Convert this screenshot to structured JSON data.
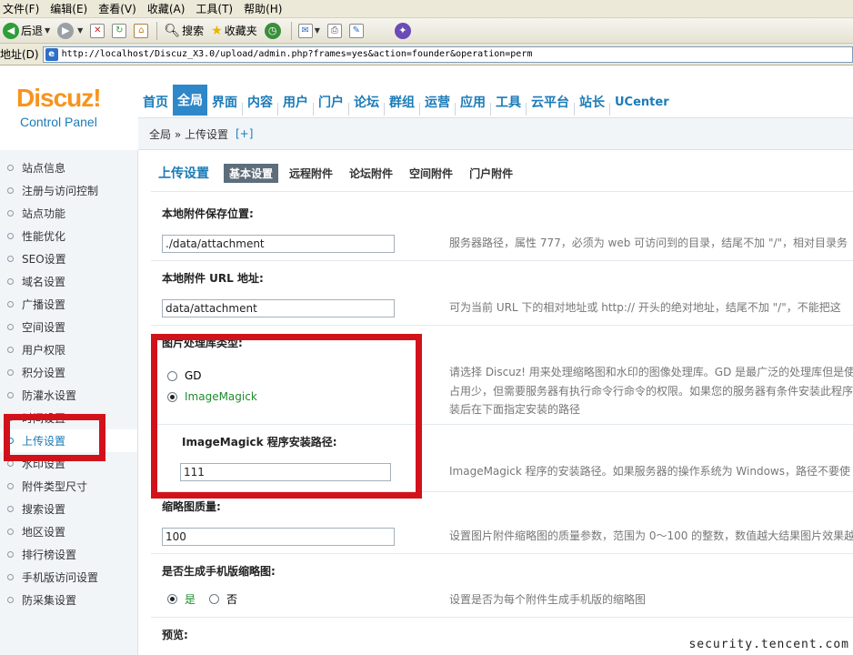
{
  "browser": {
    "menu": [
      "文件(F)",
      "编辑(E)",
      "查看(V)",
      "收藏(A)",
      "工具(T)",
      "帮助(H)"
    ],
    "toolbar": {
      "back": "后退",
      "search": "搜索",
      "favorites": "收藏夹"
    },
    "address_label": "地址(D)",
    "url": "http://localhost/Discuz_X3.0/upload/admin.php?frames=yes&action=founder&operation=perm"
  },
  "header": {
    "logo_main": "Discuz!",
    "logo_sub": "Control Panel",
    "nav": [
      "首页",
      "全局",
      "界面",
      "内容",
      "用户",
      "门户",
      "论坛",
      "群组",
      "运营",
      "应用",
      "工具",
      "云平台",
      "站长",
      "UCenter"
    ],
    "active_nav": "全局",
    "breadcrumb": "全局 » 上传设置",
    "breadcrumb_add": "[+]"
  },
  "sidebar": {
    "items": [
      "站点信息",
      "注册与访问控制",
      "站点功能",
      "性能优化",
      "SEO设置",
      "域名设置",
      "广播设置",
      "空间设置",
      "用户权限",
      "积分设置",
      "防灌水设置",
      "时间设置",
      "上传设置",
      "水印设置",
      "附件类型尺寸",
      "搜索设置",
      "地区设置",
      "排行榜设置",
      "手机版访问设置",
      "防采集设置"
    ],
    "active_item": "上传设置"
  },
  "main": {
    "title": "上传设置",
    "tabs": [
      "基本设置",
      "远程附件",
      "论坛附件",
      "空间附件",
      "门户附件"
    ],
    "active_tab": "基本设置",
    "fields": {
      "attach_dir_label": "本地附件保存位置:",
      "attach_dir_value": "./data/attachment",
      "attach_dir_hint": "服务器路径，属性 777，必须为 web 可访问到的目录，结尾不加 \"/\"，相对目录务",
      "attach_url_label": "本地附件 URL 地址:",
      "attach_url_value": "data/attachment",
      "attach_url_hint": "可为当前 URL 下的相对地址或 http:// 开头的绝对地址，结尾不加 \"/\"，不能把这",
      "image_lib_label": "图片处理库类型:",
      "image_lib_options": [
        "GD",
        "ImageMagick"
      ],
      "image_lib_selected": "ImageMagick",
      "image_lib_hint_1": "请选择 Discuz! 用来处理缩略图和水印的图像处理库。GD 是最广泛的处理库但是使",
      "image_lib_hint_2": "占用少，但需要服务器有执行命令行命令的权限。如果您的服务器有条件安装此程序",
      "image_lib_hint_3": "装后在下面指定安装的路径",
      "imagick_path_label": "ImageMagick 程序安装路径:",
      "imagick_path_value": "111",
      "imagick_path_hint": "ImageMagick 程序的安装路径。如果服务器的操作系统为 Windows，路径不要使",
      "thumb_quality_label": "缩略图质量:",
      "thumb_quality_value": "100",
      "thumb_quality_hint": "设置图片附件缩略图的质量参数，范围为 0～100 的整数，数值越大结果图片效果越",
      "mobile_thumb_label": "是否生成手机版缩略图:",
      "mobile_thumb_yes": "是",
      "mobile_thumb_no": "否",
      "mobile_thumb_selected": "是",
      "mobile_thumb_hint": "设置是否为每个附件生成手机版的缩略图",
      "preview_label": "预览:"
    }
  },
  "watermark": "security.tencent.com",
  "colors": {
    "link_blue": "#1b7bb8",
    "logo_orange": "#f7941d",
    "annotation_red": "#d2121b",
    "active_green": "#1e8c2e"
  }
}
